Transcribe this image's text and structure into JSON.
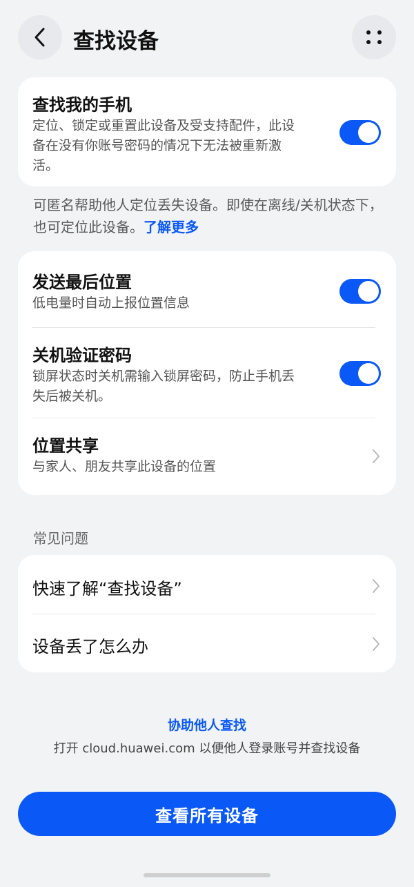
{
  "header": {
    "title": "查找设备",
    "back_icon": "chevron-left-icon",
    "more_icon": "more-dots-icon"
  },
  "find_phone": {
    "title": "查找我的手机",
    "description": "定位、锁定或重置此设备及受支持配件，此设备在没有你账号密码的情况下无法被重新激活。",
    "enabled": true
  },
  "offline_note": {
    "text": "可匿名帮助他人定位丢失设备。即使在离线/关机状态下，也可定位此设备。",
    "link": "了解更多"
  },
  "settings": {
    "send_last_location": {
      "title": "发送最后位置",
      "description": "低电量时自动上报位置信息",
      "enabled": true
    },
    "shutdown_password": {
      "title": "关机验证密码",
      "description": "锁屏状态时关机需输入锁屏密码，防止手机丢失后被关机。",
      "enabled": true
    },
    "location_sharing": {
      "title": "位置共享",
      "description": "与家人、朋友共享此设备的位置"
    }
  },
  "faq": {
    "label": "常见问题",
    "items": [
      {
        "label": "快速了解“查找设备”"
      },
      {
        "label": "设备丢了怎么办"
      }
    ]
  },
  "assist": {
    "link": "协助他人查找",
    "description": "打开 cloud.huawei.com 以便他人登录账号并查找设备"
  },
  "primary_button": {
    "label": "查看所有设备"
  },
  "colors": {
    "accent": "#0a59f7",
    "background": "#f1f3f5",
    "card": "#ffffff"
  }
}
